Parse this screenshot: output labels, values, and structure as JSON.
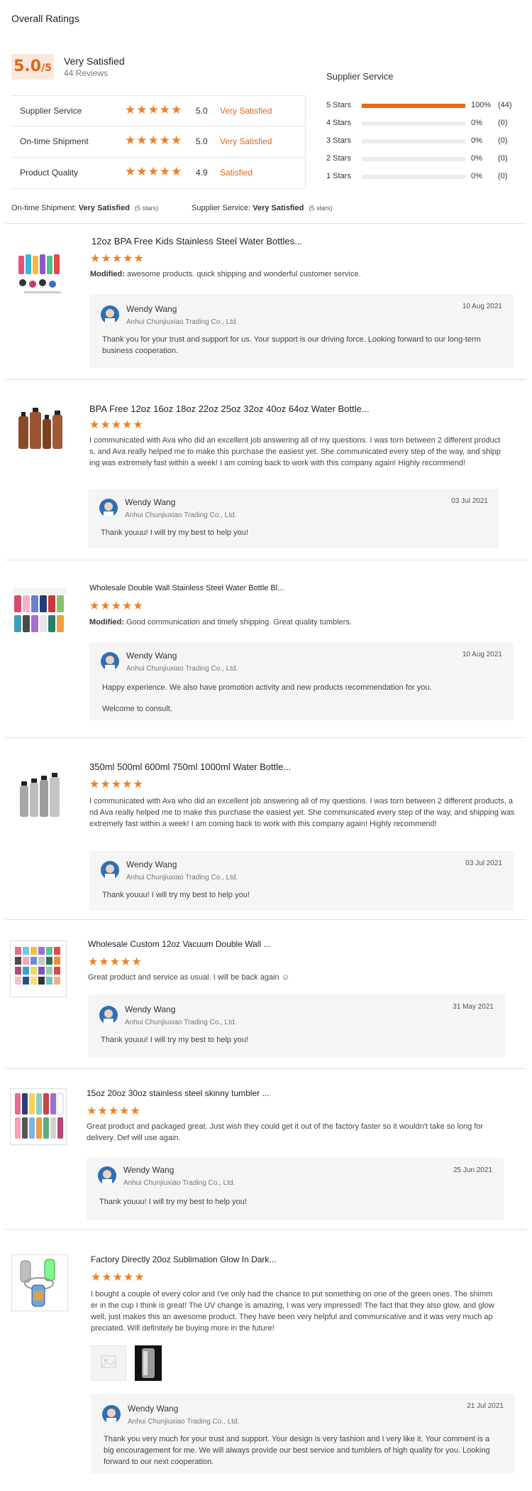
{
  "overall": {
    "title": "Overall Ratings",
    "score": "5.0",
    "score_denominator": "/5",
    "label": "Very Satisfied",
    "reviews": "44 Reviews"
  },
  "metrics": [
    {
      "name": "Supplier Service",
      "stars": "★★★★★",
      "score": "5.0",
      "text": "Very Satisfied"
    },
    {
      "name": "On-time Shipment",
      "stars": "★★★★★",
      "score": "5.0",
      "text": "Very Satisfied"
    },
    {
      "name": "Product Quality",
      "stars": "★★★★★",
      "score": "4.9",
      "text": "Satisfied"
    }
  ],
  "supplier_service": {
    "heading": "Supplier Service",
    "rows": [
      {
        "label": "5 Stars",
        "fraction": 1.0,
        "pct": "100%",
        "count": "(44)"
      },
      {
        "label": "4 Stars",
        "fraction": 0,
        "pct": "0%",
        "count": "(0)"
      },
      {
        "label": "3 Stars",
        "fraction": 0,
        "pct": "0%",
        "count": "(0)"
      },
      {
        "label": "2 Stars",
        "fraction": 0,
        "pct": "0%",
        "count": "(0)"
      },
      {
        "label": "1 Stars",
        "fraction": 0,
        "pct": "0%",
        "count": "(0)"
      }
    ]
  },
  "summary": {
    "shipment_label": "On-time Shipment:",
    "shipment_value": "Very Satisfied",
    "shipment_stars": "(5 stars)",
    "service_label": "Supplier Service:",
    "service_value": "Very Satisfied",
    "service_stars": "(5 stars)"
  },
  "reviews": [
    {
      "title": "12oz BPA Free Kids Stainless Steel Water Bottles...",
      "stars": "★★★★★",
      "modified_label": "Modified:",
      "text": "awesome products.  quick shipping and wonderful  customer  service.",
      "reply": {
        "name": "Wendy Wang",
        "company": "Anhui Chunjiuxiao Trading Co., Ltd.",
        "date": "10 Aug 2021",
        "text": "Thank you  for your trust and support for us. Your support is our driving force. Looking forward to our long-term business cooperation."
      }
    },
    {
      "title": "BPA Free 12oz 16oz 18oz 22oz 25oz 32oz 40oz 64oz Water Bottle...",
      "stars": "★★★★★",
      "modified_label": "",
      "text": "I communicated with Ava who did an excellent job answering all of my questions. I was torn between 2 different products, and Ava really helped me to make this purchase the easiest yet. She communicated every step of the way, and shipping was extremely fast within a week! I am coming back to work with this company again! Highly recommend!",
      "reply": {
        "name": "Wendy Wang",
        "company": "Anhui Chunjiuxiao Trading Co., Ltd.",
        "date": "03 Jul 2021",
        "text": "Thank youuu! I will try my best to help you!"
      }
    },
    {
      "title": "Wholesale Double Wall Stainless Steel Water Bottle Bl...",
      "stars": "★★★★★",
      "modified_label": "Modified:",
      "text": "Good communication and timely shipping. Great quality tumblers.",
      "reply": {
        "name": "Wendy Wang",
        "company": "Anhui Chunjiuxiao Trading Co., Ltd.",
        "date": "10 Aug 2021",
        "text": "Happy experience. We also have promotion activity and new products recommendation for you.",
        "text2": "Welcome to consult."
      }
    },
    {
      "title": "350ml 500ml 600ml 750ml 1000ml Water Bottle...",
      "stars": "★★★★★",
      "modified_label": "",
      "text": "I communicated with Ava who did an excellent job answering all of my questions. I was torn between 2 different products, and Ava really helped me to make this purchase the easiest yet. She communicated every step of the way, and shipping was extremely fast within a week! I am coming back to work with this company again! Highly recommend!",
      "reply": {
        "name": "Wendy Wang",
        "company": "Anhui Chunjiuxiao Trading Co., Ltd.",
        "date": "03 Jul 2021",
        "text": "Thank youuu! I will try my best to help you!"
      }
    },
    {
      "title": "Wholesale Custom 12oz Vacuum Double Wall ...",
      "stars": "★★★★★",
      "modified_label": "",
      "text": "Great product and service as usual. I will be back again ☺",
      "reply": {
        "name": "Wendy Wang",
        "company": "Anhui Chunjiuxiao Trading Co., Ltd.",
        "date": "31 May 2021",
        "text": "Thank youuu! I will try my best to help you!"
      }
    },
    {
      "title": "15oz 20oz 30oz stainless steel skinny tumbler ...",
      "stars": "★★★★★",
      "modified_label": "",
      "text": "Great product and packaged great.  Just wish they could get it out of the factory faster so it wouldn't take so long for delivery.  Def will use again.",
      "reply": {
        "name": "Wendy Wang",
        "company": "Anhui Chunjiuxiao Trading Co., Ltd.",
        "date": "25 Jun 2021",
        "text": "Thank youuu! I will try my best to help you!"
      }
    },
    {
      "title": "Factory Directly 20oz Sublimation Glow In Dark...",
      "stars": "★★★★★",
      "modified_label": "",
      "text": "I bought a couple of every color and I've only had the chance to put something on one of the green ones. The shimmer in the cup I think is great! The UV change is amazing, I was very impressed! The fact that they also glow, and glow well, just makes this an awesome product. They have been very helpful and communicative and it was very much appreciated. Will definitely be buying more in the future!",
      "reply": {
        "name": "Wendy Wang",
        "company": "Anhui Chunjiuxiao Trading Co., Ltd.",
        "date": "21 Jul 2021",
        "text": "Thank you very much for your trust and support. Your design is very fashion and I very like it. Your comment is a big encouragement for me. We will always provide our best service and tumblers of high quality for you. Looking forward to our next cooperation."
      }
    }
  ],
  "colors": {
    "accent": "#e86a1c",
    "star": "#f08022",
    "reply_bg": "#f5f5f6"
  }
}
